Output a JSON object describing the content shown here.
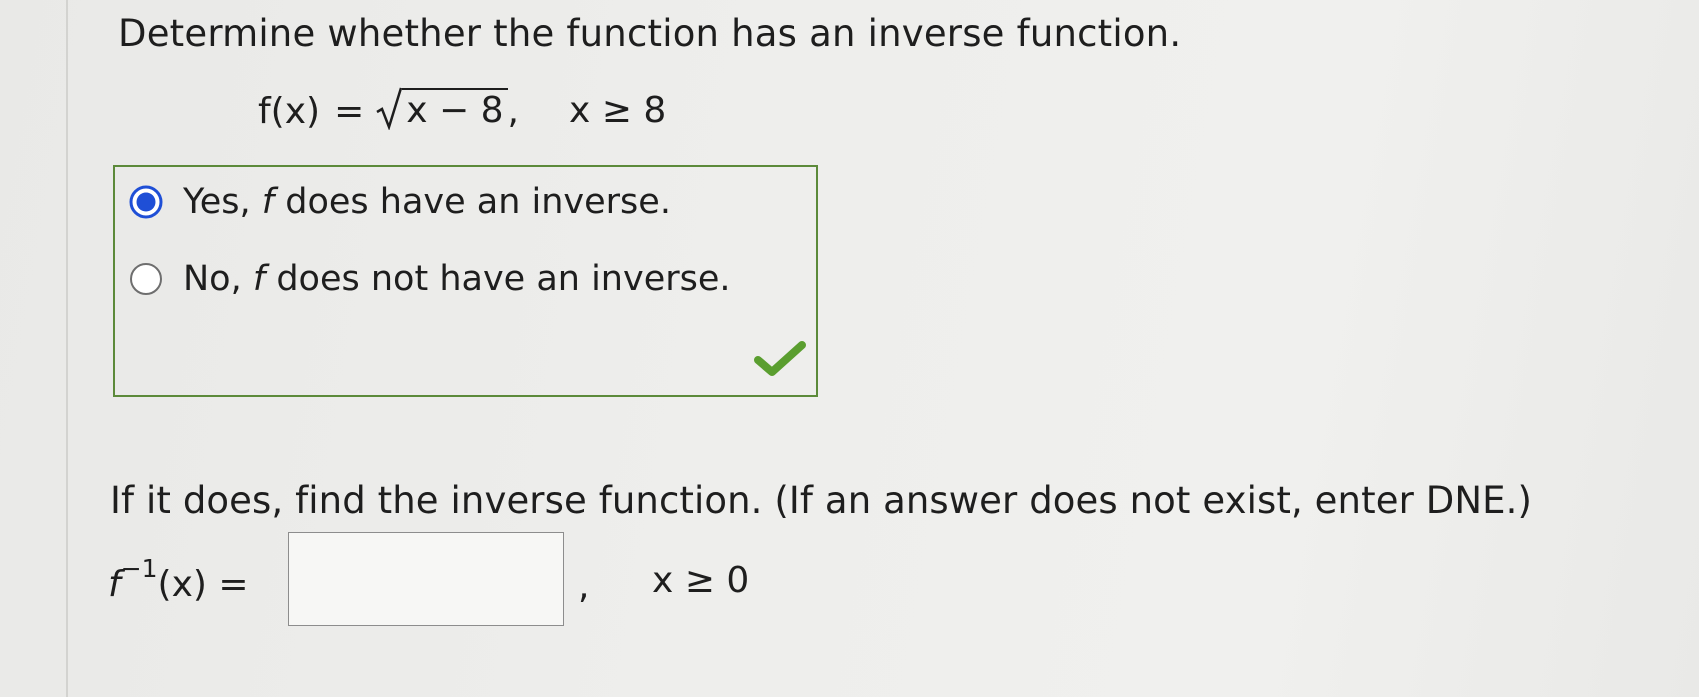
{
  "question": {
    "prompt": "Determine whether the function has an inverse function.",
    "equation": {
      "lhs": "f(x)",
      "equals": "=",
      "radicand": "x − 8",
      "separator": ",",
      "condition": "x ≥ 8"
    }
  },
  "choices": {
    "options": [
      {
        "prefix": "Yes,",
        "variable": "f",
        "suffix": "does have an inverse.",
        "selected": true
      },
      {
        "prefix": "No,",
        "variable": "f",
        "suffix": "does not have an inverse.",
        "selected": false
      }
    ],
    "status": "correct",
    "status_icon": "checkmark-icon",
    "border_color": "#5c8a3a",
    "radio_selected_color": "#1f4fd6",
    "check_color": "#5a9e2f"
  },
  "followup": {
    "prompt": "If it does, find the inverse function. (If an answer does not exist, enter DNE.)",
    "inverse": {
      "function_name": "f",
      "exponent": "−1",
      "argument": "(x)",
      "equals": "=",
      "input_value": "",
      "separator": ",",
      "condition": "x ≥ 0"
    }
  }
}
